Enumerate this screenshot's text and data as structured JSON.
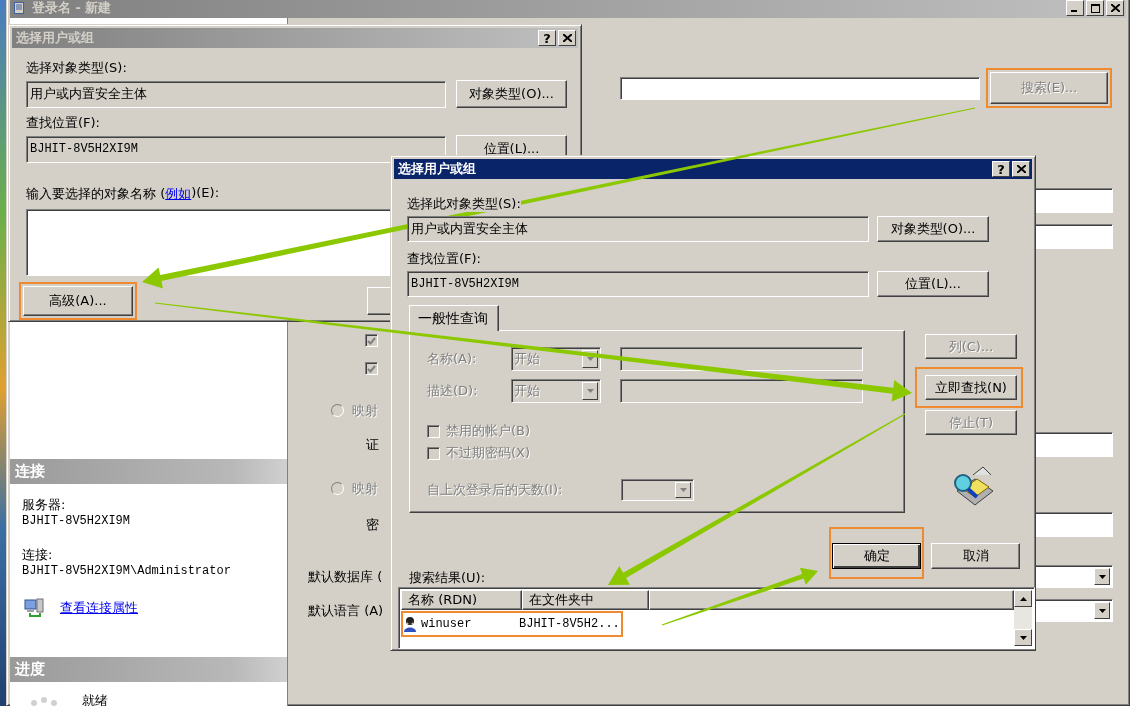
{
  "main_window": {
    "title": "登录名 - 新建",
    "active": false,
    "search_button": {
      "label": "搜索(E)...",
      "disabled": true,
      "highlighted": true
    },
    "options": [
      {
        "kind": "field"
      },
      {
        "kind": "field"
      },
      {
        "kind": "checkbox",
        "checked": true,
        "disabled": true
      },
      {
        "kind": "checkbox",
        "checked": true,
        "disabled": true
      },
      {
        "kind": "radio",
        "label": "映射",
        "selected": false,
        "disabled": true
      },
      {
        "kind": "sublabel",
        "label": "证"
      },
      {
        "kind": "radio",
        "label": "映射",
        "selected": false,
        "disabled": true
      },
      {
        "kind": "sublabel",
        "label": "密"
      },
      {
        "kind": "combo",
        "label": "默认数据库 ("
      },
      {
        "kind": "combo",
        "label": "默认语言 (A)"
      }
    ],
    "connection_header": "连接",
    "server_label": "服务器:",
    "server": "BJHIT-8V5H2XI9M",
    "connection_label": "连接:",
    "connection": "BJHIT-8V5H2XI9M\\Administrator",
    "properties_link": "查看连接属性",
    "progress_header": "进度",
    "progress_status": "就绪"
  },
  "back_dialog": {
    "title": "选择用户或组",
    "active": false,
    "help": "?",
    "object_type_label": "选择对象类型(S):",
    "object_type": "用户或内置安全主体",
    "object_type_button": "对象类型(O)...",
    "location_label": "查找位置(F):",
    "location": "BJHIT-8V5H2XI9M",
    "location_button": "位置(L)...",
    "names_label": "输入要选择的对象名称 (",
    "names_link": "例如",
    "names_label_end": ")(E):",
    "advanced_button": {
      "label": "高级(A)...",
      "highlighted": true
    }
  },
  "front_dialog": {
    "title": "选择用户或组",
    "active": true,
    "help": "?",
    "object_type_label": "选择此对象类型(S):",
    "object_type": "用户或内置安全主体",
    "object_type_button": "对象类型(O)...",
    "location_label": "查找位置(F):",
    "location": "BJHIT-8V5H2XI9M",
    "location_button": "位置(L)...",
    "tabs": [
      {
        "label": "一般性查询",
        "selected": true
      }
    ],
    "query_disabled": true,
    "query_rows": [
      {
        "label": "名称(A):",
        "combo": "开始"
      },
      {
        "label": "描述(D):",
        "combo": "开始"
      }
    ],
    "query_checks": [
      {
        "label": "禁用的帐户(B)",
        "checked": false
      },
      {
        "label": "不过期密码(X)",
        "checked": false
      }
    ],
    "days_label": "自上次登录后的天数(I):",
    "side_buttons": [
      {
        "label": "列(C)...",
        "disabled": true,
        "highlighted": false
      },
      {
        "label": "立即查找(N)",
        "disabled": false,
        "highlighted": true
      },
      {
        "label": "停止(T)",
        "disabled": true,
        "highlighted": false
      }
    ],
    "ok_button": {
      "label": "确定",
      "highlighted": true
    },
    "cancel_button": {
      "label": "取消",
      "highlighted": false
    },
    "results_label": "搜索结果(U):",
    "columns": [
      "名称 (RDN)",
      "在文件夹中"
    ],
    "rows": [
      {
        "name": "winuser",
        "folder": "BJHIT-8V5H2...",
        "highlighted": true
      }
    ]
  }
}
